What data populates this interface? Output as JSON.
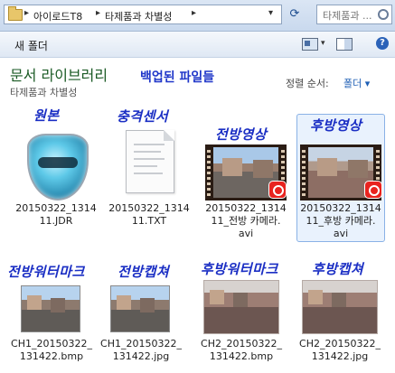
{
  "address_bar": {
    "crumbs": [
      "아이로드T8",
      "타제품과 차별성"
    ],
    "search_placeholder": "타제품과 ..."
  },
  "toolbar": {
    "new_folder_label": "새 폴더"
  },
  "library": {
    "title": "문서 라이브러리",
    "subtitle": "타제품과 차별성",
    "overlay_heading": "백업된 파일들",
    "sort_label": "정렬 순서:",
    "sort_value": "폴더"
  },
  "row1": [
    {
      "caption": "원본",
      "name_line1": "20150322_1314",
      "name_line2": "11.JDR",
      "name_line3": "",
      "icon": "jdr-shield-icon",
      "selected": false
    },
    {
      "caption": "충격센서",
      "name_line1": "20150322_1314",
      "name_line2": "11.TXT",
      "name_line3": "",
      "icon": "text-document-icon",
      "selected": false
    },
    {
      "caption": "전방영상",
      "name_line1": "20150322_1314",
      "name_line2": "11_전방 카메라.",
      "name_line3": "avi",
      "icon": "video-thumbnail-icon",
      "selected": false
    },
    {
      "caption": "후방영상",
      "name_line1": "20150322_1314",
      "name_line2": "11_후방 카메라.",
      "name_line3": "avi",
      "icon": "video-thumbnail-icon",
      "selected": true
    }
  ],
  "row2": [
    {
      "caption": "전방워터마크",
      "name_line1": "CH1_20150322_",
      "name_line2": "131422.bmp",
      "icon": "image-thumbnail-icon"
    },
    {
      "caption": "전방캡쳐",
      "name_line1": "CH1_20150322_",
      "name_line2": "131422.jpg",
      "icon": "image-thumbnail-icon"
    },
    {
      "caption": "후방워터마크",
      "name_line1": "CH2_20150322_",
      "name_line2": "131422.bmp",
      "icon": "image-thumbnail-icon"
    },
    {
      "caption": "후방캡쳐",
      "name_line1": "CH2_20150322_",
      "name_line2": "131422.jpg",
      "icon": "image-thumbnail-icon"
    }
  ],
  "colors": {
    "caption": "#1b2fc4",
    "library_title": "#1a5a24",
    "selection": "#e9f2fd",
    "badge": "#e8231f"
  }
}
